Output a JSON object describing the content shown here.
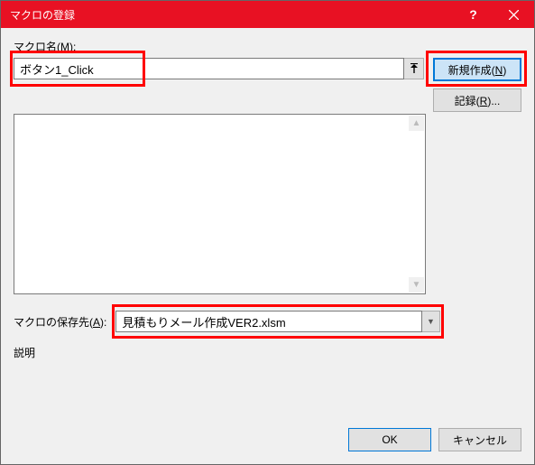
{
  "window": {
    "title": "マクロの登録",
    "help": "?",
    "close": "×"
  },
  "labels": {
    "macro_name_pre": "マクロ名(",
    "macro_name_key": "M",
    "macro_name_post": "):",
    "store_pre": "マクロの保存先(",
    "store_key": "A",
    "store_post": "):",
    "description": "説明"
  },
  "values": {
    "macro_name": "ボタン1_Click",
    "store_location": "見積もりメール作成VER2.xlsm"
  },
  "buttons": {
    "new_pre": "新規作成(",
    "new_key": "N",
    "new_post": ")",
    "record_pre": "記録(",
    "record_key": "R",
    "record_post": ")...",
    "ok": "OK",
    "cancel": "キャンセル"
  }
}
